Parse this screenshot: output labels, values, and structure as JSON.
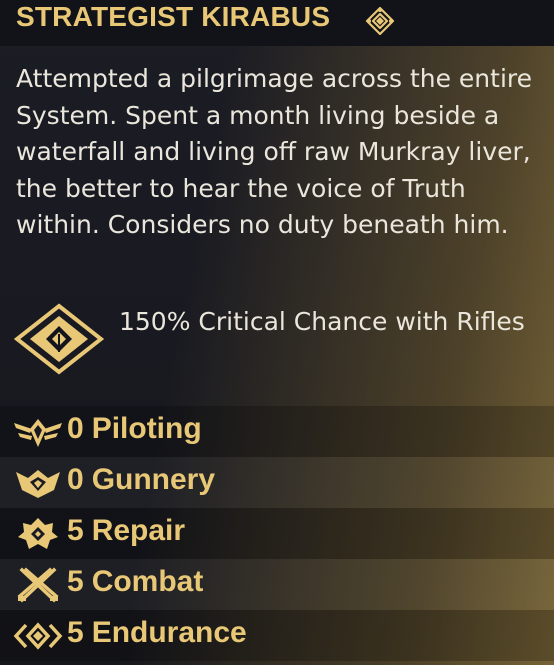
{
  "character": {
    "name": "STRATEGIST KIRABUS",
    "name_icon": "faction-emblem-icon",
    "bio": "Attempted a pilgrimage across the entire System. Spent a month living beside a waterfall and living off raw Murkray liver, the better to hear the voice of Truth within. Considers no duty beneath him."
  },
  "trait": {
    "icon": "gold-diamond-trait-icon",
    "text": "150% Critical Chance with Rifles"
  },
  "skills": [
    {
      "value": "0",
      "label": "Piloting",
      "icon": "piloting-wings-icon"
    },
    {
      "value": "0",
      "label": "Gunnery",
      "icon": "gunnery-crown-icon"
    },
    {
      "value": "5",
      "label": "Repair",
      "icon": "repair-gear-icon"
    },
    {
      "value": "5",
      "label": "Combat",
      "icon": "combat-crossed-swords-icon"
    },
    {
      "value": "5",
      "label": "Endurance",
      "icon": "endurance-chevrons-icon"
    }
  ],
  "colors": {
    "accent_gold": "#e8c877",
    "text_light": "#eae6dc",
    "background_dark": "#1b1c24"
  }
}
